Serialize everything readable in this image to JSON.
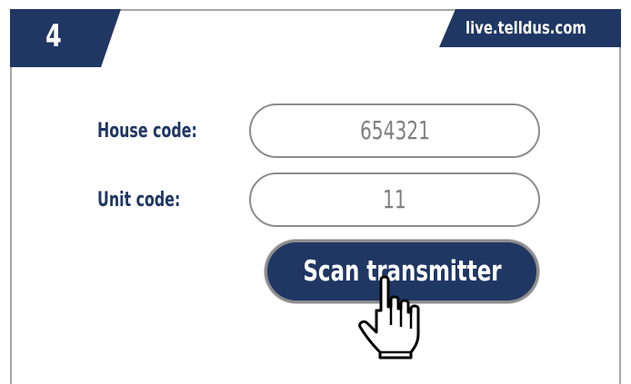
{
  "step": {
    "number": "4"
  },
  "header": {
    "url": "live.telldus.com"
  },
  "form": {
    "house_code_label": "House code:",
    "house_code_value": "654321",
    "unit_code_label": "Unit code:",
    "unit_code_value": "11",
    "scan_button_label": "Scan transmitter"
  },
  "icons": {
    "cursor": "hand-pointer-icon"
  },
  "colors": {
    "brand_navy": "#203764",
    "field_border": "#8c8c8c",
    "field_text": "#7f7f7f",
    "frame_border": "#a6a6a6"
  }
}
